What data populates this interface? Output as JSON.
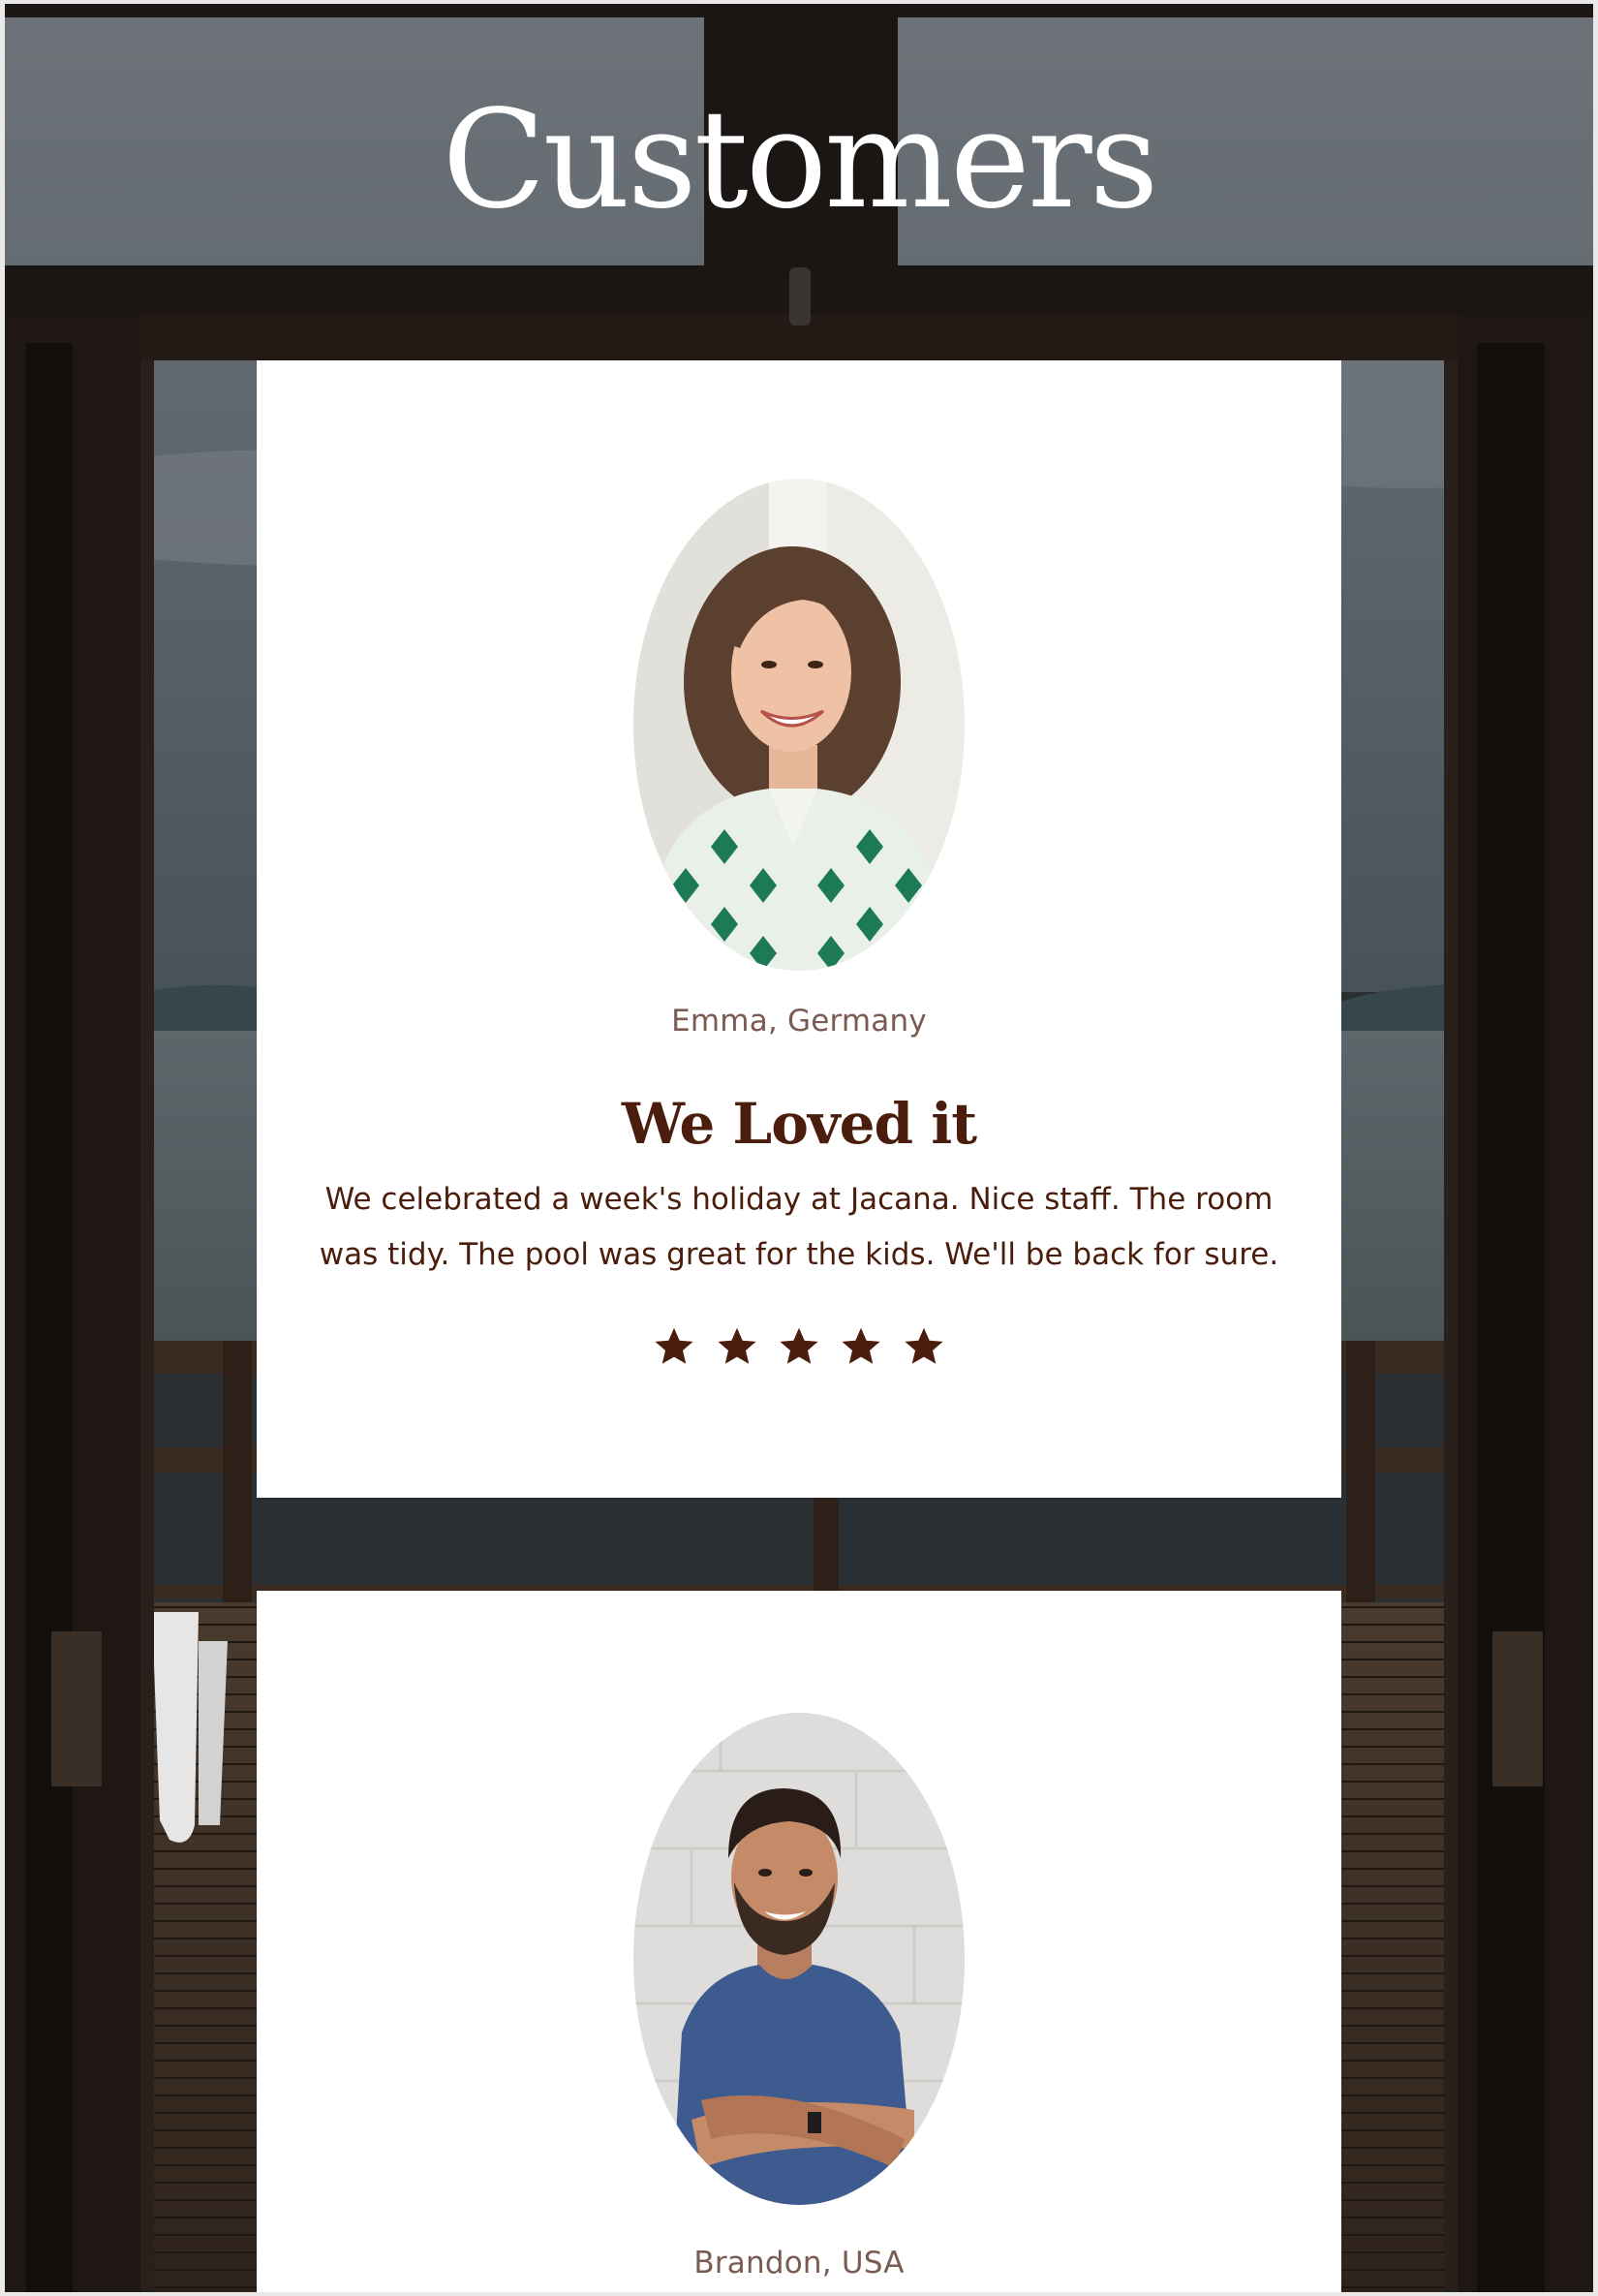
{
  "section": {
    "title": "Customers"
  },
  "testimonials": [
    {
      "name": "Emma, Germany",
      "heading": "We Loved it",
      "text": "We celebrated a week's holiday at Jacana. Nice staff. The room was tidy. The pool was great for the kids. We'll be back for sure.",
      "rating": 5,
      "rating_max": 5
    },
    {
      "name": "Brandon, USA"
    }
  ],
  "colors": {
    "heading_text": "#4a1d0c",
    "name_text": "#7a5b52",
    "star": "#4a1d0c",
    "card_bg": "#ffffff",
    "title_text": "#ffffff"
  },
  "icons": {
    "rating_star": "star-icon"
  }
}
